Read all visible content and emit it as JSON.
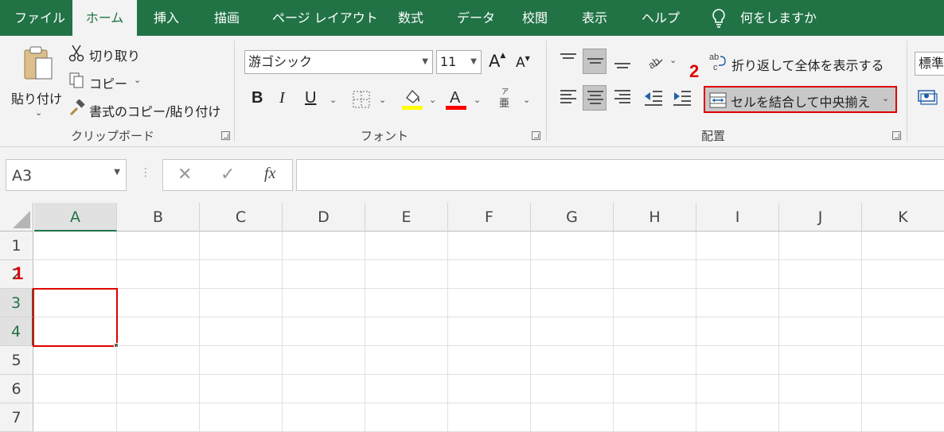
{
  "tabs": {
    "file": "ファイル",
    "home": "ホーム",
    "insert": "挿入",
    "draw": "描画",
    "page_layout": "ページ レイアウト",
    "formulas": "数式",
    "data": "データ",
    "review": "校閲",
    "view": "表示",
    "help": "ヘルプ",
    "tell_me": "何をしますか"
  },
  "clipboard": {
    "paste_label": "貼り付け",
    "cut_label": "切り取り",
    "copy_label": "コピー",
    "format_painter_label": "書式のコピー/貼り付け",
    "group_label": "クリップボード"
  },
  "font": {
    "name": "游ゴシック",
    "size": "11",
    "group_label": "フォント",
    "bold": "B",
    "italic": "I",
    "underline": "U",
    "grow": "A",
    "shrink": "A",
    "highlight_color": "#ffff00",
    "font_color": "#ff0000"
  },
  "alignment": {
    "wrap_text_label": "折り返して全体を表示する",
    "merge_center_label": "セルを結合して中央揃え",
    "group_label": "配置"
  },
  "number": {
    "format": "標準"
  },
  "formula_bar": {
    "name_box": "A3",
    "fx": "fx",
    "value": ""
  },
  "grid": {
    "columns": [
      "A",
      "B",
      "C",
      "D",
      "E",
      "F",
      "G",
      "H",
      "I",
      "J",
      "K"
    ],
    "rows": [
      "1",
      "2",
      "3",
      "4",
      "5",
      "6",
      "7"
    ],
    "selected_range": "A3:A4"
  },
  "steps": {
    "step1": "1",
    "step2": "2"
  },
  "colors": {
    "accent": "#217346",
    "highlight_border": "#e00000"
  }
}
